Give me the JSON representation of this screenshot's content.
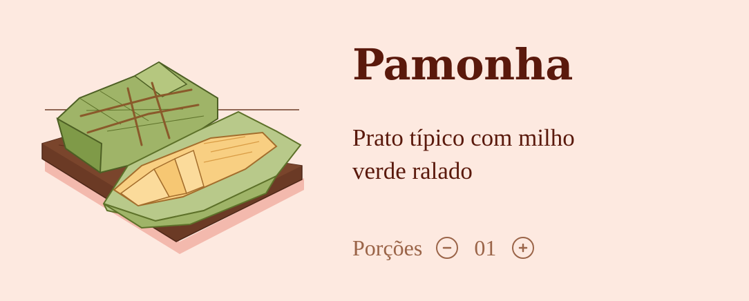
{
  "dish": {
    "title": "Pamonha",
    "description": "Prato típico com milho verde ralado"
  },
  "portions": {
    "label": "Porções",
    "value": "01"
  },
  "icons": {
    "decrease": "minus-circle-icon",
    "increase": "plus-circle-icon",
    "illustration": "pamonha-illustration"
  },
  "colors": {
    "background": "#fde9e0",
    "title": "#5a190c",
    "muted": "#9a6448",
    "husk": "#9fb468",
    "corn": "#f8cf82",
    "board": "#6b3a25"
  }
}
